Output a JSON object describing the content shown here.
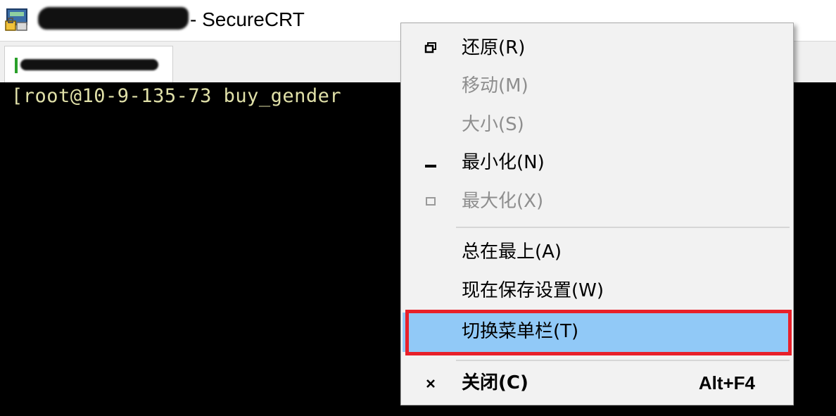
{
  "window": {
    "title": "- SecureCRT"
  },
  "terminal": {
    "prompt": "[root@10-9-135-73 buy_gender"
  },
  "context_menu": {
    "items": [
      {
        "label": "还原(R)",
        "icon": "restore-icon",
        "enabled": true
      },
      {
        "label": "移动(M)",
        "icon": "",
        "enabled": false
      },
      {
        "label": "大小(S)",
        "icon": "",
        "enabled": false
      },
      {
        "label": "最小化(N)",
        "icon": "minimize-icon",
        "enabled": true
      },
      {
        "label": "最大化(X)",
        "icon": "maximize-icon",
        "enabled": false
      },
      {
        "label": "总在最上(A)",
        "icon": "",
        "enabled": true
      },
      {
        "label": "现在保存设置(W)",
        "icon": "",
        "enabled": true
      },
      {
        "label": "切换菜单栏(T)",
        "icon": "",
        "enabled": true,
        "highlighted": true
      },
      {
        "label": "关闭(C)",
        "icon": "close-icon",
        "enabled": true,
        "shortcut": "Alt+F4"
      }
    ]
  },
  "colors": {
    "highlight": "#91c9f7",
    "annotation": "#e8202a",
    "terminal_bg": "#000000",
    "terminal_fg": "#e0e0a8"
  }
}
